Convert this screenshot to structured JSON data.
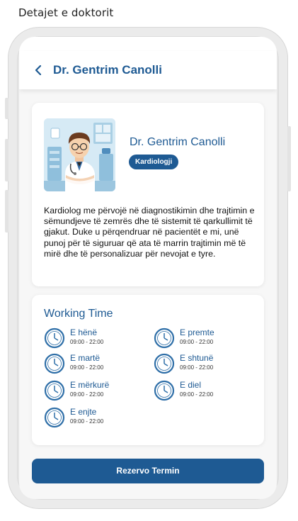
{
  "caption": "Detajet e doktorit",
  "header": {
    "title": "Dr. Gentrim Canolli",
    "back_icon": "chevron-left-icon"
  },
  "doctor": {
    "name": "Dr. Gentrim Canolli",
    "specialty": "Kardiologji",
    "bio": "Kardiolog me përvojë në diagnostikimin dhe trajtimin e sëmundjeve të zemrës dhe të sistemit të qarkullimit të gjakut. Duke u përqendruar në pacientët e mi, unë punoj për të siguruar që ata të marrin trajtimin më të mirë dhe të personalizuar për nevojat e tyre."
  },
  "working_time": {
    "title": "Working Time",
    "days": [
      {
        "name": "E hënë",
        "hours": "09:00 - 22:00"
      },
      {
        "name": "E martë",
        "hours": "09:00 - 22:00"
      },
      {
        "name": "E mërkurë",
        "hours": "09:00 - 22:00"
      },
      {
        "name": "E enjte",
        "hours": "09:00 - 22:00"
      },
      {
        "name": "E premte",
        "hours": "09:00 - 22:00"
      },
      {
        "name": "E shtunë",
        "hours": "09:00 - 22:00"
      },
      {
        "name": "E diel",
        "hours": "09:00 - 22:00"
      }
    ]
  },
  "actions": {
    "reserve_label": "Rezervo Termin"
  },
  "colors": {
    "primary": "#1e5a93",
    "screen_bg": "#f7f7f7",
    "card_bg": "#ffffff"
  }
}
